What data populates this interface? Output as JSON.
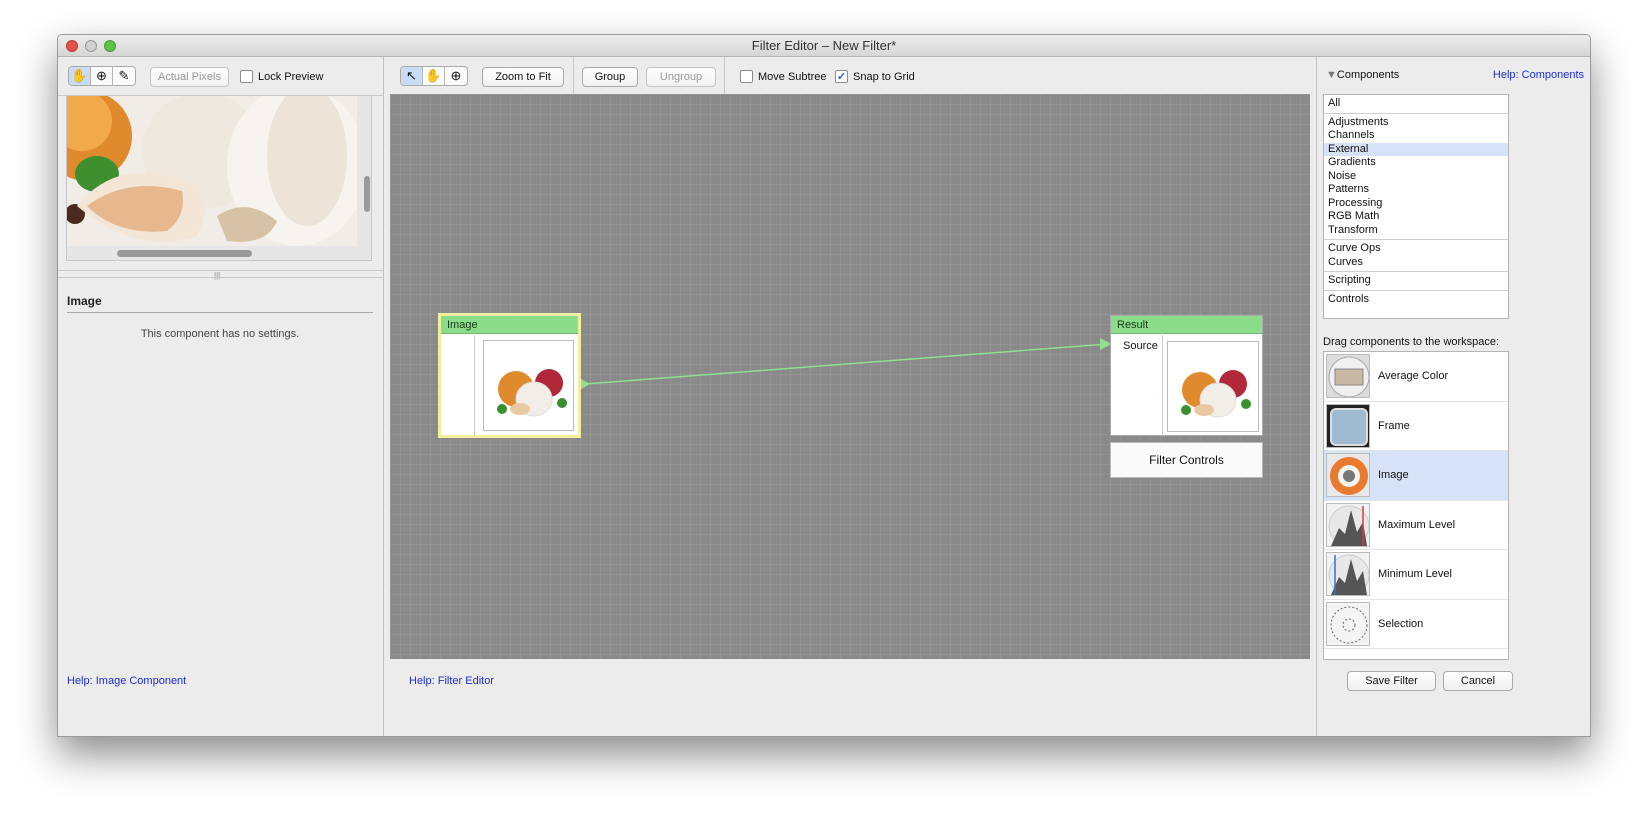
{
  "window": {
    "title": "Filter Editor – New Filter*"
  },
  "left_toolbar": {
    "tools": [
      "hand-icon",
      "zoom-in-icon",
      "eyedropper-icon"
    ],
    "actual_pixels": "Actual Pixels",
    "lock_preview": "Lock Preview",
    "lock_preview_checked": false
  },
  "inspector": {
    "title": "Image",
    "message": "This component has no settings.",
    "help_link": "Help: Image Component"
  },
  "main_toolbar": {
    "tools": [
      "arrow-pointer-icon",
      "hand-icon",
      "zoom-in-icon"
    ],
    "zoom_to_fit": "Zoom to Fit",
    "group": "Group",
    "ungroup": "Ungroup",
    "move_subtree": "Move Subtree",
    "move_subtree_checked": false,
    "snap_to_grid": "Snap to Grid",
    "snap_to_grid_checked": true
  },
  "workspace": {
    "image_node": {
      "title": "Image"
    },
    "result_node": {
      "title": "Result",
      "port": "Source"
    },
    "filter_controls": "Filter Controls",
    "help_link": "Help: Filter Editor"
  },
  "components_panel": {
    "header": "Components",
    "help_link": "Help: Components",
    "categories": [
      {
        "label": "All"
      },
      {
        "divider": true
      },
      {
        "label": "Adjustments"
      },
      {
        "label": "Channels"
      },
      {
        "label": "External",
        "selected": true
      },
      {
        "label": "Gradients"
      },
      {
        "label": "Noise"
      },
      {
        "label": "Patterns"
      },
      {
        "label": "Processing"
      },
      {
        "label": "RGB Math"
      },
      {
        "label": "Transform"
      },
      {
        "divider": true
      },
      {
        "label": "Curve Ops"
      },
      {
        "label": "Curves"
      },
      {
        "divider": true
      },
      {
        "label": "Scripting"
      },
      {
        "divider": true
      },
      {
        "label": "Controls"
      }
    ],
    "drag_hint": "Drag components to the workspace:",
    "items": [
      {
        "label": "Average Color",
        "icon": "average-color-icon"
      },
      {
        "label": "Frame",
        "icon": "frame-icon"
      },
      {
        "label": "Image",
        "icon": "image-component-icon",
        "selected": true
      },
      {
        "label": "Maximum Level",
        "icon": "maximum-level-icon"
      },
      {
        "label": "Minimum Level",
        "icon": "minimum-level-icon"
      },
      {
        "label": "Selection",
        "icon": "selection-icon"
      }
    ]
  },
  "footer": {
    "save": "Save Filter",
    "cancel": "Cancel"
  }
}
